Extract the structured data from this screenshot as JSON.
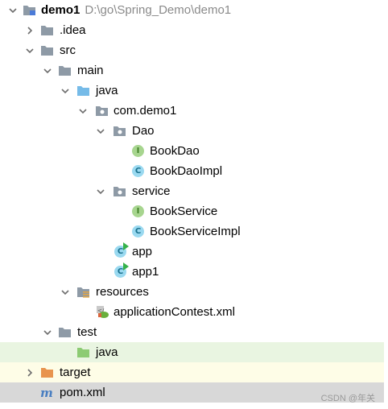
{
  "tree": {
    "root": {
      "name": "demo1",
      "path": "D:\\go\\Spring_Demo\\demo1"
    },
    "nodes": [
      {
        "label": ".idea"
      },
      {
        "label": "src"
      },
      {
        "label": "main"
      },
      {
        "label": "java"
      },
      {
        "label": "com.demo1"
      },
      {
        "label": "Dao"
      },
      {
        "label": "BookDao",
        "kind": "interface"
      },
      {
        "label": "BookDaoImpl",
        "kind": "class"
      },
      {
        "label": "service"
      },
      {
        "label": "BookService",
        "kind": "interface"
      },
      {
        "label": "BookServiceImpl",
        "kind": "class"
      },
      {
        "label": "app",
        "kind": "runnable-class"
      },
      {
        "label": "app1",
        "kind": "runnable-class"
      },
      {
        "label": "resources"
      },
      {
        "label": "applicationContest.xml"
      },
      {
        "label": "test"
      },
      {
        "label": "java"
      },
      {
        "label": "target"
      },
      {
        "label": "pom.xml"
      }
    ],
    "icon_letters": {
      "interface": "I",
      "class": "C"
    }
  },
  "watermark": "CSDN @年关",
  "colors": {
    "folder": "#8e9aa6",
    "source_folder": "#76bbe8",
    "test_folder": "#8ccb73",
    "excluded_folder": "#e8944e",
    "test_row": "#e9f5e1",
    "target_row": "#fefde7",
    "pom_row": "#d8d8d8"
  }
}
